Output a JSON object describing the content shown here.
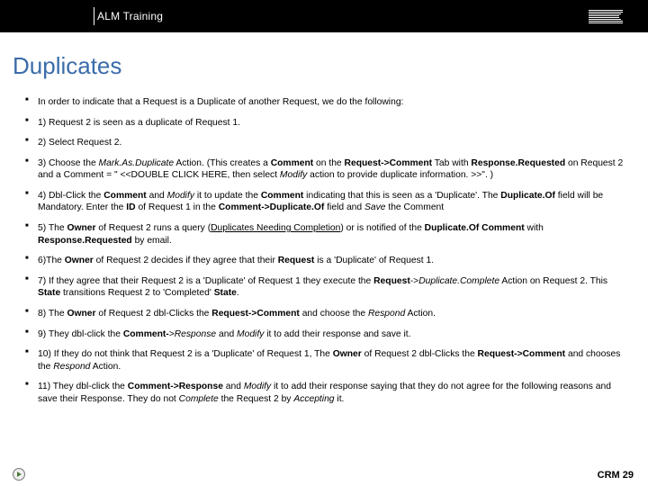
{
  "header": {
    "product": "ALM Training",
    "logo_name": "ibm-logo"
  },
  "title": "Duplicates",
  "bullets": [
    {
      "html": "In order to indicate that a Request is a Duplicate of another Request, we do the following:"
    },
    {
      "html": "1)  Request 2 is seen as a duplicate of Request 1."
    },
    {
      "html": "2) Select Request 2."
    },
    {
      "html": "3) Choose the <i>Mark.As.Duplicate</i> Action. (This creates a <b>Comment</b> on the <b>Request-&gt;Comment</b> Tab with <b>Response.Requested</b> on Request 2 and a Comment = \" &lt;&lt;DOUBLE CLICK HERE, then select <i>Modify</i> action to provide duplicate information. &gt;&gt;\". )"
    },
    {
      "html": "4) Dbl-Click the <b>Comment</b> and <i>Modify</i> it to update the <b>Comment</b> indicating that this is seen as a 'Duplicate'. The <b>Duplicate.Of</b> field will be Mandatory. Enter the <b>ID</b> of Request 1 in the <b>Comment-&gt;Duplicate.Of</b>  field and <i>Save</i> the Comment"
    },
    {
      "html": "5) The <b>Owner</b> of Request 2 runs a query (<u>Duplicates Needing Completion</u>) or is notified of the <b>Duplicate.Of Comment</b> with <b>Response.Requested</b> by email."
    },
    {
      "html": "6)The <b>Owner</b> of Request 2 decides if they agree that their <b>Request</b> is a 'Duplicate' of Request 1."
    },
    {
      "html": "7) If they agree that their Request 2 is a 'Duplicate' of Request 1 they execute the <b>Request</b>-&gt;<i>Duplicate.Complete</i> Action on Request 2.  This <b>State</b> transitions Request 2 to 'Completed' <b>State</b>."
    },
    {
      "html": "8) The <b>Owner</b> of Request 2 dbl-Clicks the <b>Request-&gt;Comment</b> and choose the <i>Respond</i> Action."
    },
    {
      "html": "9) They dbl-click the <b>Comment-</b>&gt;<i>Response</i> and <i>Modify</i> it to add their response and save it."
    },
    {
      "html": "10) If they do not think that Request 2 is a 'Duplicate' of Request 1,  The <b>Owner</b> of Request 2 dbl-Clicks the <b>Request-&gt;Comment</b> and chooses the <i>Respond</i> Action."
    },
    {
      "html": "11) They dbl-click the <b>Comment-&gt;Response</b> and <i>Modify</i> it to add their response saying that they do not agree for the following reasons and save their Response.  They do not <i>Complete</i> the Request 2 by <i>Accepting</i> it."
    }
  ],
  "footer": {
    "label": "CRM 29"
  }
}
